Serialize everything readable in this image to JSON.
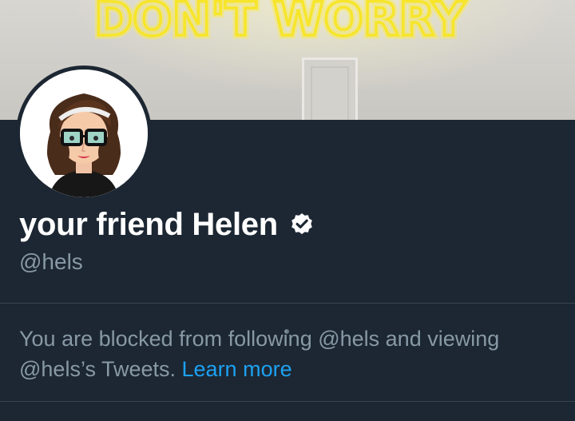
{
  "banner": {
    "neon_text": "DON'T WORRY"
  },
  "profile": {
    "display_name": "your friend Helen",
    "handle": "@hels",
    "verified_icon": "verified-badge-icon"
  },
  "blocked": {
    "message": "You are blocked from following @hels and viewing @hels’s Tweets.",
    "link_label": "Learn more"
  },
  "colors": {
    "background": "#1c2733",
    "link": "#1da1f2",
    "muted_text": "#8899a6",
    "neon": "#f7e52b"
  }
}
